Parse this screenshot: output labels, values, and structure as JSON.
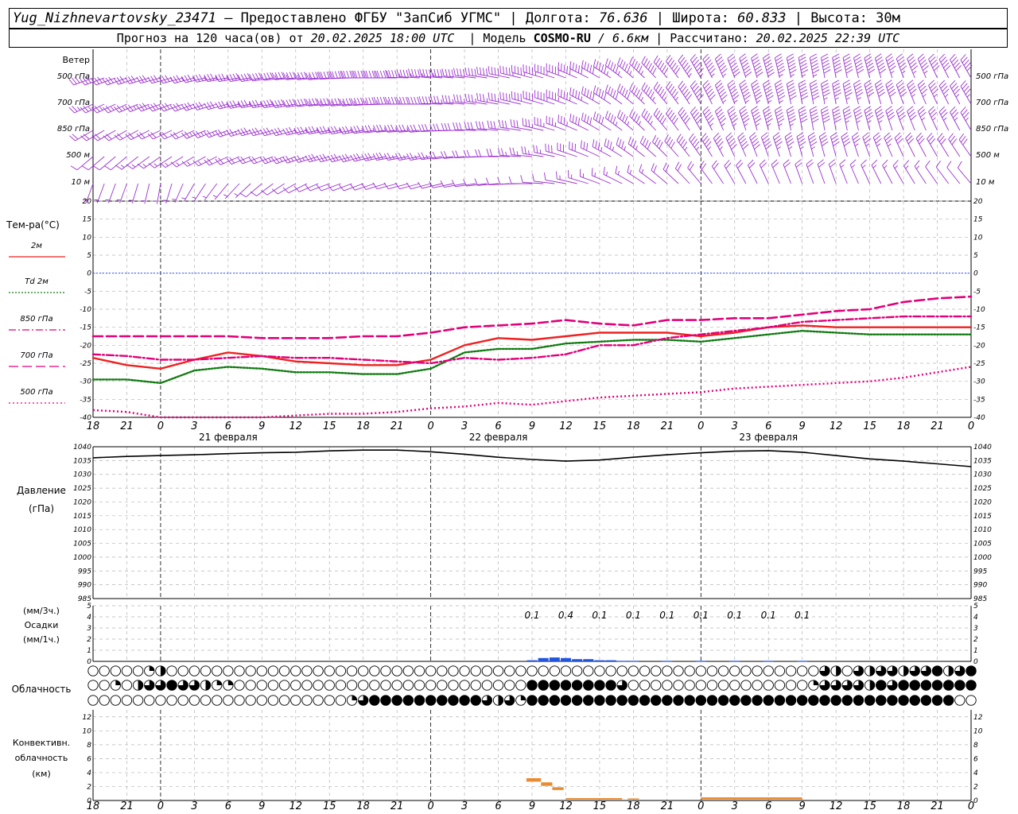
{
  "header": {
    "station": "Yug_Nizhnevartovsky_23471",
    "provider_text": "– Предоставлено ФГБУ \"ЗапСиб УГМС\"",
    "sep": "|",
    "lon_label": "Долгота:",
    "lon_value": "76.636",
    "lat_label": "Широта:",
    "lat_value": "60.833",
    "alt_label": "Высота:",
    "alt_value": "30м",
    "forecast_prefix": "Прогноз на 120 часа(ов) от",
    "forecast_start": "20.02.2025 18:00 UTC",
    "model_label": "Модель",
    "model_name": "COSMO-RU",
    "model_res": "/ 6.6км",
    "computed_label": "Рассчитано:",
    "computed_time": "20.02.2025 22:39 UTC"
  },
  "time_axis": {
    "hour_labels": [
      "18",
      "21",
      "0",
      "3",
      "6",
      "9",
      "12",
      "15",
      "18",
      "21",
      "0",
      "3",
      "6",
      "9",
      "12",
      "15",
      "18",
      "21",
      "0",
      "3",
      "6",
      "9",
      "12",
      "15",
      "18",
      "21",
      "0"
    ],
    "day_labels": [
      {
        "text": "21 февраля",
        "slot": 4
      },
      {
        "text": "22 февраля",
        "slot": 12
      },
      {
        "text": "23 февраля",
        "slot": 20
      }
    ],
    "midnight_slots": [
      2,
      10,
      18,
      26
    ]
  },
  "wind_panel": {
    "title": "Ветер",
    "levels": [
      "500 гПа",
      "700 гПа",
      "850 гПа",
      "500 м",
      "10  м"
    ],
    "color": "#9b30d0",
    "barb_hours": [
      0,
      3,
      6,
      9,
      12,
      15,
      18,
      21,
      24,
      27,
      30,
      33,
      36,
      39,
      42,
      45,
      48,
      51,
      54,
      57,
      60,
      63,
      66,
      69,
      72,
      75,
      78
    ],
    "speed_ms": [
      [
        15,
        15,
        16,
        17,
        18,
        20,
        22,
        24,
        24,
        24,
        22,
        20,
        20,
        22,
        24,
        26,
        28,
        30,
        32,
        34,
        34,
        32,
        30,
        30,
        28,
        26,
        26
      ],
      [
        12,
        13,
        14,
        15,
        16,
        18,
        20,
        22,
        22,
        22,
        20,
        18,
        18,
        20,
        22,
        24,
        26,
        28,
        30,
        32,
        32,
        30,
        28,
        26,
        24,
        22,
        22
      ],
      [
        9,
        9,
        10,
        11,
        12,
        14,
        16,
        18,
        18,
        18,
        16,
        14,
        14,
        16,
        18,
        20,
        22,
        24,
        26,
        28,
        28,
        26,
        24,
        22,
        20,
        18,
        18
      ],
      [
        6,
        6,
        7,
        8,
        9,
        10,
        12,
        14,
        14,
        14,
        12,
        10,
        10,
        12,
        14,
        16,
        18,
        20,
        22,
        24,
        24,
        22,
        20,
        18,
        16,
        14,
        14
      ],
      [
        3,
        3,
        2,
        3,
        3,
        4,
        5,
        6,
        6,
        6,
        5,
        4,
        4,
        5,
        6,
        7,
        8,
        9,
        10,
        11,
        11,
        10,
        9,
        8,
        7,
        6,
        6
      ]
    ],
    "direction_deg": [
      [
        250,
        250,
        255,
        255,
        260,
        260,
        265,
        265,
        270,
        270,
        275,
        275,
        280,
        285,
        290,
        300,
        310,
        320,
        330,
        340,
        345,
        350,
        350,
        345,
        340,
        335,
        330
      ],
      [
        245,
        245,
        250,
        250,
        255,
        260,
        260,
        265,
        265,
        270,
        270,
        275,
        280,
        285,
        290,
        300,
        310,
        320,
        330,
        340,
        345,
        350,
        350,
        345,
        340,
        335,
        330
      ],
      [
        240,
        240,
        245,
        245,
        250,
        255,
        255,
        260,
        260,
        265,
        265,
        270,
        275,
        280,
        290,
        300,
        310,
        320,
        330,
        340,
        345,
        350,
        350,
        345,
        340,
        335,
        330
      ],
      [
        230,
        230,
        235,
        240,
        245,
        250,
        250,
        255,
        255,
        260,
        260,
        265,
        270,
        275,
        285,
        295,
        305,
        315,
        325,
        335,
        340,
        345,
        345,
        340,
        335,
        330,
        325
      ],
      [
        200,
        200,
        190,
        210,
        220,
        230,
        240,
        250,
        250,
        255,
        255,
        260,
        265,
        270,
        280,
        290,
        300,
        310,
        320,
        330,
        335,
        340,
        340,
        335,
        330,
        325,
        320
      ]
    ]
  },
  "temperature_panel": {
    "title": "Тем-ра(°C)",
    "legend": [
      {
        "label": "2м",
        "color": "#ee2222",
        "style": "solid"
      },
      {
        "label": "Td  2м",
        "color": "#107a10",
        "style": "dotted"
      },
      {
        "label": "850 гПа",
        "color": "#e0007a",
        "style": "dashdot"
      },
      {
        "label": "700 гПа",
        "color": "#e0007a",
        "style": "longdash"
      },
      {
        "label": "500 гПа",
        "color": "#e0007a",
        "style": "dot"
      }
    ],
    "zero_line_color": "#3355ff"
  },
  "pressure_panel": {
    "title": "Давление",
    "unit": "(гПа)"
  },
  "precip_panel": {
    "title": "Осадки",
    "unit_top": "(мм/3ч.)",
    "unit_bottom": "(мм/1ч.)",
    "labels": [
      {
        "hour": 39,
        "text": "0.1"
      },
      {
        "hour": 42,
        "text": "0.4"
      },
      {
        "hour": 45,
        "text": "0.1"
      },
      {
        "hour": 48,
        "text": "0.1"
      },
      {
        "hour": 51,
        "text": "0.1"
      },
      {
        "hour": 54,
        "text": "0.1"
      },
      {
        "hour": 57,
        "text": "0.1"
      },
      {
        "hour": 60,
        "text": "0.1"
      },
      {
        "hour": 63,
        "text": "0.1"
      }
    ],
    "bar_color": "#2255dd"
  },
  "cloud_panel": {
    "title": "Облачность"
  },
  "convective_panel": {
    "title_1": "Конвективн.",
    "title_2": "облачность",
    "unit": "(км)",
    "bar_color": "#e88a30"
  },
  "chart_data": [
    {
      "type": "line",
      "title": "Тем-ра(°C)",
      "x_unit": "hours from 20.02.2025 18:00 UTC",
      "ylim": [
        -40,
        20
      ],
      "yticks": [
        20,
        15,
        10,
        5,
        0,
        -5,
        -10,
        -15,
        -20,
        -25,
        -30,
        -35,
        -40
      ],
      "grid": true,
      "x": [
        0,
        3,
        6,
        9,
        12,
        15,
        18,
        21,
        24,
        27,
        30,
        33,
        36,
        39,
        42,
        45,
        48,
        51,
        54,
        57,
        60,
        63,
        66,
        69,
        72,
        75,
        78
      ],
      "series": [
        {
          "name": "2м",
          "values": [
            -23.5,
            -25.5,
            -26.5,
            -24,
            -22,
            -23,
            -24.5,
            -25,
            -25.5,
            -25.5,
            -24,
            -20,
            -18,
            -18.5,
            -17.5,
            -16.5,
            -16.5,
            -16.5,
            -17.5,
            -16.5,
            -15,
            -14.5,
            -15,
            -15,
            -15,
            -15,
            -15
          ]
        },
        {
          "name": "Td  2м",
          "values": [
            -29.5,
            -29.5,
            -30.5,
            -27,
            -26,
            -26.5,
            -27.5,
            -27.5,
            -28,
            -28,
            -26.5,
            -22,
            -21,
            -21,
            -19.5,
            -19,
            -18.5,
            -18.5,
            -19,
            -18,
            -17,
            -16,
            -16.5,
            -17,
            -17,
            -17,
            -17
          ]
        },
        {
          "name": "850 гПа",
          "values": [
            -22.5,
            -23,
            -24,
            -24,
            -23.5,
            -23,
            -23.5,
            -23.5,
            -24,
            -24.5,
            -25,
            -23.5,
            -24,
            -23.5,
            -22.5,
            -20,
            -20,
            -18,
            -17,
            -16,
            -15,
            -13.5,
            -13,
            -12.5,
            -12,
            -12,
            -12
          ]
        },
        {
          "name": "700 гПа",
          "values": [
            -17.5,
            -17.5,
            -17.5,
            -17.5,
            -17.5,
            -18,
            -18,
            -18,
            -17.5,
            -17.5,
            -16.5,
            -15,
            -14.5,
            -14,
            -13,
            -14,
            -14.5,
            -13,
            -13,
            -12.5,
            -12.5,
            -11.5,
            -10.5,
            -10,
            -8,
            -7,
            -6.5
          ]
        },
        {
          "name": "500 гПа",
          "values": [
            -38,
            -38.5,
            -40,
            -41,
            -42,
            -40,
            -39.5,
            -39,
            -39,
            -38.5,
            -37.5,
            -37,
            -36,
            -36.5,
            -35.5,
            -34.5,
            -34,
            -33.5,
            -33,
            -32,
            -31.5,
            -31,
            -30.5,
            -30,
            -29,
            -27.5,
            -26
          ]
        }
      ]
    },
    {
      "type": "line",
      "title": "Давление",
      "ylabel": "(гПа)",
      "x_unit": "hours from 20.02.2025 18:00 UTC",
      "ylim": [
        985,
        1040
      ],
      "yticks": [
        1040,
        1035,
        1030,
        1025,
        1020,
        1015,
        1010,
        1005,
        1000,
        995,
        990,
        985
      ],
      "grid": true,
      "x": [
        0,
        3,
        6,
        9,
        12,
        15,
        18,
        21,
        24,
        27,
        30,
        33,
        36,
        39,
        42,
        45,
        48,
        51,
        54,
        57,
        60,
        63,
        66,
        69,
        72,
        75,
        78
      ],
      "series": [
        {
          "name": "Давление",
          "values": [
            1036,
            1036.5,
            1036.8,
            1037.1,
            1037.5,
            1037.8,
            1038,
            1038.5,
            1038.8,
            1038.8,
            1038.2,
            1037.3,
            1036.2,
            1035.4,
            1034.8,
            1035.2,
            1036.2,
            1037.1,
            1037.8,
            1038.4,
            1038.6,
            1038,
            1036.8,
            1035.6,
            1034.8,
            1033.8,
            1032.8
          ]
        }
      ]
    },
    {
      "type": "bar",
      "title": "Осадки",
      "ylabel": "(мм/3ч.) (мм/1ч.)",
      "x_unit": "hours from 20.02.2025 18:00 UTC",
      "ylim": [
        0,
        5
      ],
      "yticks": [
        5,
        4,
        3,
        2,
        1,
        0
      ],
      "x": [
        39,
        40,
        41,
        42,
        43,
        44,
        45,
        46,
        47,
        48,
        51,
        54,
        57,
        60,
        63
      ],
      "series": [
        {
          "name": "Осадки",
          "values": [
            0.1,
            0.3,
            0.35,
            0.3,
            0.2,
            0.2,
            0.1,
            0.1,
            0.05,
            0.05,
            0.05,
            0.05,
            0.05,
            0.05,
            0.05
          ]
        }
      ]
    },
    {
      "type": "bar",
      "title": "Конвективн. облачность",
      "ylabel": "(км)",
      "x_unit": "hours from 20.02.2025 18:00 UTC",
      "ylim": [
        0,
        13
      ],
      "yticks": [
        12,
        10,
        8,
        6,
        4,
        2,
        0
      ],
      "bars": [
        {
          "x0": 38.5,
          "x1": 39.8,
          "bottom": 2.7,
          "top": 3.2
        },
        {
          "x0": 39.8,
          "x1": 40.8,
          "bottom": 2.1,
          "top": 2.6
        },
        {
          "x0": 40.8,
          "x1": 41.8,
          "bottom": 1.5,
          "top": 1.9
        },
        {
          "x0": 42,
          "x1": 47,
          "bottom": 0.15,
          "top": 0.35
        },
        {
          "x0": 47.5,
          "x1": 48.5,
          "bottom": 0.15,
          "top": 0.3
        },
        {
          "x0": 54,
          "x1": 63,
          "bottom": 0.15,
          "top": 0.45
        }
      ]
    },
    {
      "type": "table",
      "title": "Облачность",
      "rows_meaning": [
        "upper",
        "middle",
        "lower"
      ],
      "x_unit": "hours from 20.02.2025 18:00 UTC (1-hour steps)",
      "cover_percent": [
        [
          0,
          0,
          0,
          0,
          0,
          25,
          50,
          0,
          0,
          0,
          0,
          0,
          0,
          0,
          0,
          0,
          0,
          0,
          0,
          0,
          0,
          0,
          0,
          0,
          0,
          0,
          0,
          0,
          0,
          0,
          0,
          0,
          0,
          0,
          0,
          0,
          0,
          0,
          0,
          0,
          0,
          0,
          0,
          0,
          0,
          0,
          0,
          0,
          0,
          0,
          0,
          0,
          0,
          0,
          0,
          0,
          0,
          0,
          0,
          0,
          0,
          0,
          0,
          0,
          0,
          0,
          0,
          0,
          0,
          0,
          0,
          0,
          0,
          0,
          0,
          0,
          0,
          0,
          0,
          0,
          0,
          0,
          0,
          0,
          0,
          0,
          0,
          0,
          0,
          0,
          0,
          0,
          0,
          0,
          0,
          0,
          0,
          0,
          0,
          0,
          0,
          0,
          0,
          0,
          0,
          0,
          0,
          0,
          0,
          0,
          0,
          0,
          0,
          0,
          0,
          0,
          0,
          0,
          0,
          0,
          0,
          0,
          0,
          0,
          0,
          0,
          0,
          0,
          0,
          0,
          0,
          0,
          0,
          0,
          0,
          0,
          0,
          0,
          0,
          0,
          0,
          0,
          0,
          0,
          0,
          0,
          0,
          0,
          0,
          0,
          0,
          0,
          0,
          0,
          0,
          0,
          0,
          0,
          0,
          0,
          0,
          0,
          0,
          0,
          0,
          0,
          0,
          0,
          0,
          0,
          0,
          0,
          0,
          0,
          0,
          0,
          0,
          0,
          0,
          0,
          0,
          0,
          0,
          0,
          0,
          0,
          0,
          0,
          0,
          0,
          0,
          0,
          0,
          0,
          0,
          0,
          0,
          0,
          0,
          0,
          0,
          0,
          0,
          0,
          0,
          0,
          0,
          0,
          0,
          0,
          0,
          0,
          0,
          0,
          0,
          0,
          0,
          0,
          0,
          0,
          0,
          0,
          75,
          50,
          0,
          75,
          50,
          75,
          75,
          50,
          75,
          75,
          0,
          50,
          75,
          75,
          100,
          75,
          75,
          100
        ]
      ]
    }
  ]
}
